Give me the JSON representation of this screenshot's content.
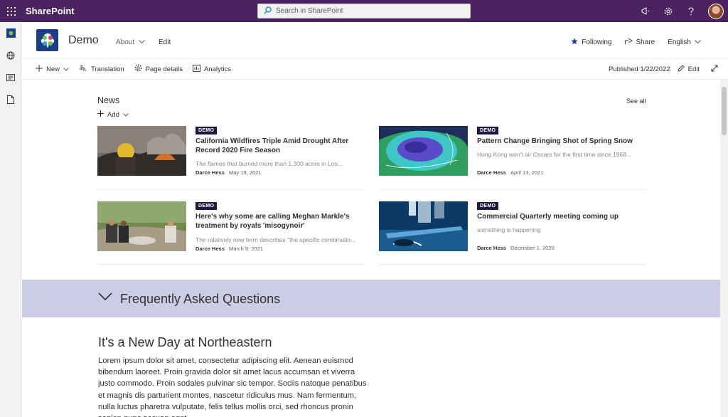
{
  "suitebar": {
    "app_name": "SharePoint",
    "search_placeholder": "Search in SharePoint"
  },
  "site": {
    "title": "Demo",
    "nav_about": "About",
    "nav_edit": "Edit",
    "following_label": "Following",
    "share_label": "Share",
    "language_label": "English"
  },
  "commandbar": {
    "new_label": "New",
    "translation_label": "Translation",
    "page_details_label": "Page details",
    "analytics_label": "Analytics",
    "published_text": "Published 1/22/2022",
    "edit_label": "Edit"
  },
  "news": {
    "title": "News",
    "see_all": "See all",
    "add_label": "Add",
    "items": [
      {
        "tag": "DEMO",
        "title": "California Wildfires Triple Amid Drought After Record 2020 Fire Season",
        "description": "The flames that burned more than 1,300 acres in Los...",
        "author": "Darce Hess",
        "date": "May 19, 2021"
      },
      {
        "tag": "DEMO",
        "title": "Pattern Change Bringing Shot of Spring Snow",
        "description": "Hong Kong won't air Oscars for the first time since 1968...",
        "author": "Darce Hess",
        "date": "April 13, 2021"
      },
      {
        "tag": "DEMO",
        "title": "Here's why some are calling Meghan Markle's treatment by royals 'misogynoir'",
        "description": "The relatively new term describes \"the specific combinatio...",
        "author": "Darce Hess",
        "date": "March 9, 2021"
      },
      {
        "tag": "DEMO",
        "title": "Commercial Quarterly meeting coming up",
        "description": "something is happening",
        "author": "Darce Hess",
        "date": "December 1, 2020"
      }
    ]
  },
  "faq": {
    "label": "Frequently Asked Questions"
  },
  "article": {
    "heading": "It's a New Day at Northeastern",
    "body": "Lorem ipsum dolor sit amet, consectetur adipiscing elit. Aenean euismod bibendum laoreet. Proin gravida dolor sit amet lacus accumsan et viverra justo commodo. Proin sodales pulvinar sic tempor. Sociis natoque penatibus et magnis dis parturient montes, nascetur ridiculus mus. Nam fermentum, nulla luctus pharetra vulputate, felis tellus mollis orci, sed rhoncus pronin sapien nunc accuan eget."
  },
  "colors": {
    "suitebar": "#4a2360",
    "faq_band": "#cccce6",
    "tag_bg": "#1b1a3e"
  },
  "icons": [
    "waffle-icon",
    "search-icon",
    "megaphone-icon",
    "gear-icon",
    "help-icon",
    "star-icon",
    "share-icon",
    "plus-icon",
    "translation-icon",
    "gear-icon",
    "analytics-icon",
    "pencil-icon",
    "expand-icon",
    "chevron-down-icon"
  ]
}
